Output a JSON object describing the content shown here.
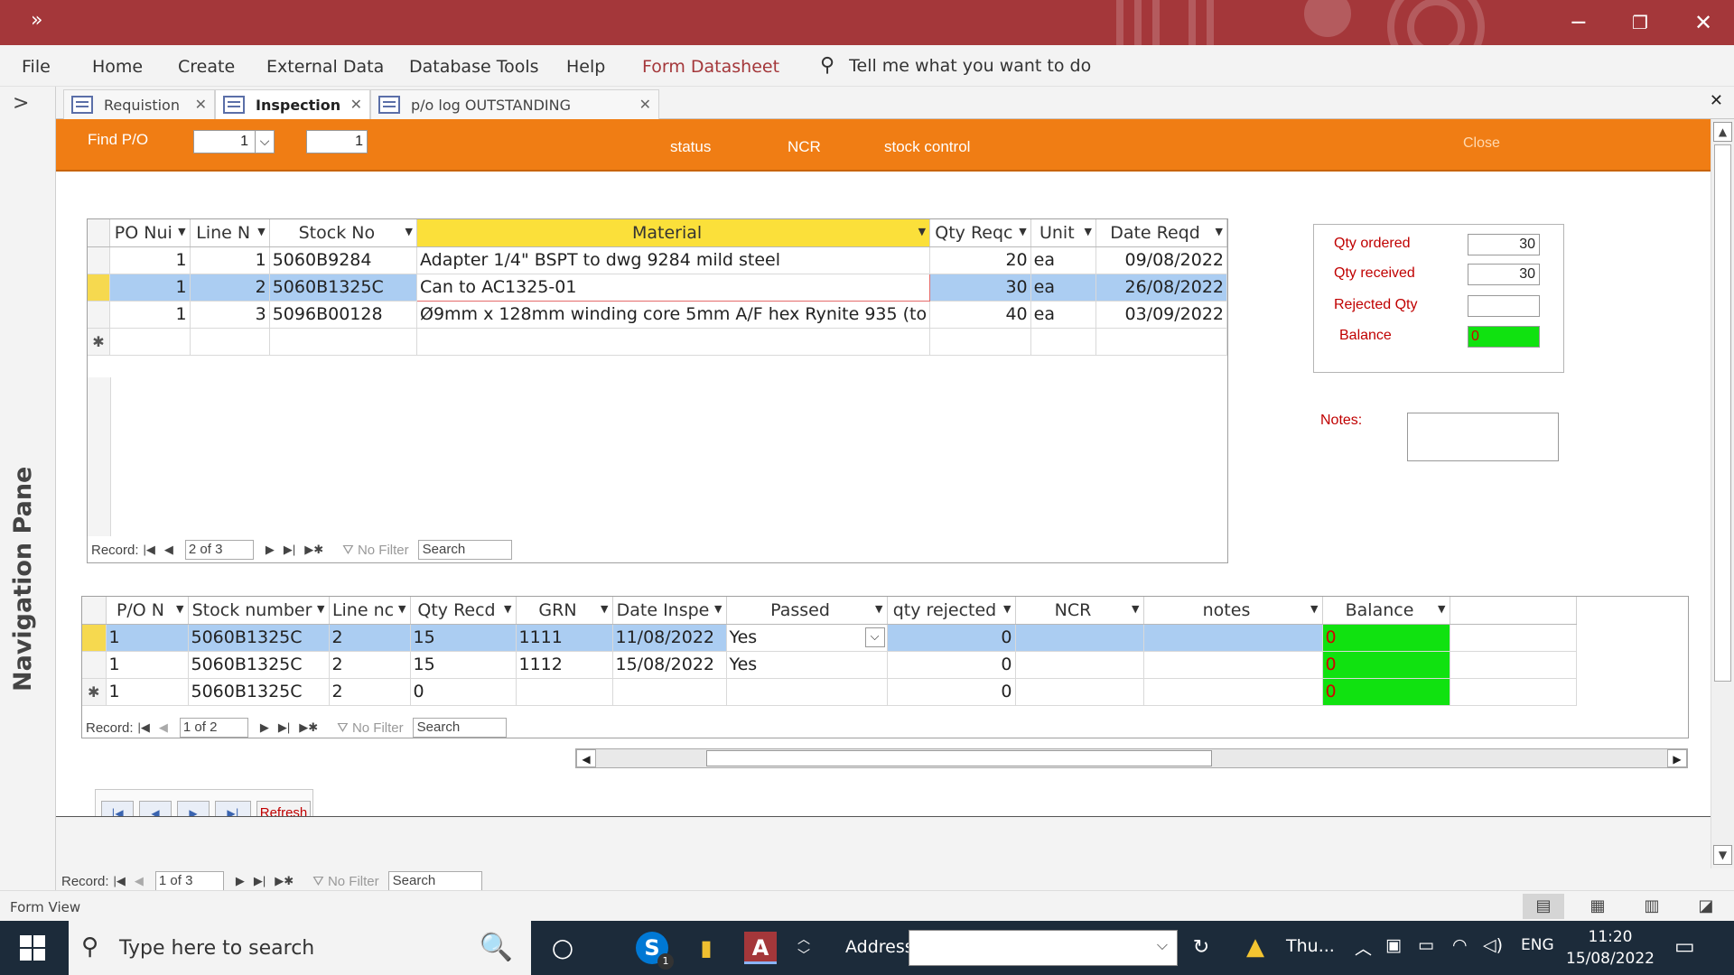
{
  "window": {
    "quick_access": "»",
    "minimize": "─",
    "restore": "❐",
    "close": "✕"
  },
  "ribbon": {
    "tabs": [
      "File",
      "Home",
      "Create",
      "External Data",
      "Database Tools",
      "Help",
      "Form Datasheet"
    ],
    "tell_me": "Tell me what you want to do"
  },
  "nav_pane": {
    "label": "Navigation Pane",
    "chevron": ">"
  },
  "doc_tabs": [
    {
      "label": "Requistion"
    },
    {
      "label": "Inspection"
    },
    {
      "label": "p/o log OUTSTANDING"
    }
  ],
  "header": {
    "find_po_label": "Find P/O",
    "find_po_value": "1",
    "second_value": "1",
    "status": "status",
    "ncr": "NCR",
    "stock_control": "stock control",
    "close": "Close"
  },
  "po_lines": {
    "columns": [
      "PO Nui",
      "Line N",
      "Stock No",
      "Material",
      "Qty Reqc",
      "Unit",
      "Date Reqd"
    ],
    "rows": [
      [
        "1",
        "1",
        "5060B9284",
        "Adapter 1/4\" BSPT to dwg 9284 mild steel",
        "20",
        "ea",
        "09/08/2022"
      ],
      [
        "1",
        "2",
        "5060B1325C",
        "Can to AC1325-01",
        "30",
        "ea",
        "26/08/2022"
      ],
      [
        "1",
        "3",
        "5096B00128",
        "Ø9mm x 128mm winding core 5mm A/F hex Rynite 935 (to",
        "40",
        "ea",
        "03/09/2022"
      ]
    ],
    "new_marker": "✱",
    "nav": {
      "record_label": "Record:",
      "position": "2 of 3",
      "no_filter": "No Filter",
      "search": "Search"
    }
  },
  "summary": {
    "qty_ordered_label": "Qty ordered",
    "qty_ordered": "30",
    "qty_received_label": "Qty received",
    "qty_received": "30",
    "rejected_label": "Rejected Qty",
    "rejected": "",
    "balance_label": "Balance",
    "balance": "0",
    "notes_label": "Notes:"
  },
  "inspections": {
    "columns": [
      "P/O N",
      "Stock number",
      "Line nc",
      "Qty Recd",
      "GRN",
      "Date Inspe",
      "Passed",
      "qty rejected",
      "NCR",
      "notes",
      "Balance"
    ],
    "rows": [
      [
        "1",
        "5060B1325C",
        "2",
        "15",
        "1111",
        "11/08/2022",
        "Yes",
        "0",
        "",
        "",
        "0"
      ],
      [
        "1",
        "5060B1325C",
        "2",
        "15",
        "1112",
        "15/08/2022",
        "Yes",
        "0",
        "",
        "",
        "0"
      ],
      [
        "1",
        "5060B1325C",
        "2",
        "0",
        "",
        "",
        "",
        "0",
        "",
        "",
        "0"
      ]
    ],
    "new_marker": "✱",
    "nav": {
      "record_label": "Record:",
      "position": "1 of 2",
      "no_filter": "No Filter",
      "search": "Search"
    }
  },
  "buttons": {
    "refresh": "Refresh"
  },
  "main_nav": {
    "record_label": "Record:",
    "position": "1 of 3",
    "no_filter": "No Filter",
    "search": "Search"
  },
  "status_bar": {
    "text": "Form View"
  },
  "taskbar": {
    "search_placeholder": "Type here to search",
    "address_label": "Address",
    "weather": "Thu...",
    "language": "ENG",
    "time": "11:20",
    "date": "15/08/2022",
    "skype_badge": "1"
  },
  "colors": {
    "title": "#a4373a",
    "header_band": "#f07d14",
    "balance_ok": "#10e210",
    "label_red": "#c00000"
  }
}
